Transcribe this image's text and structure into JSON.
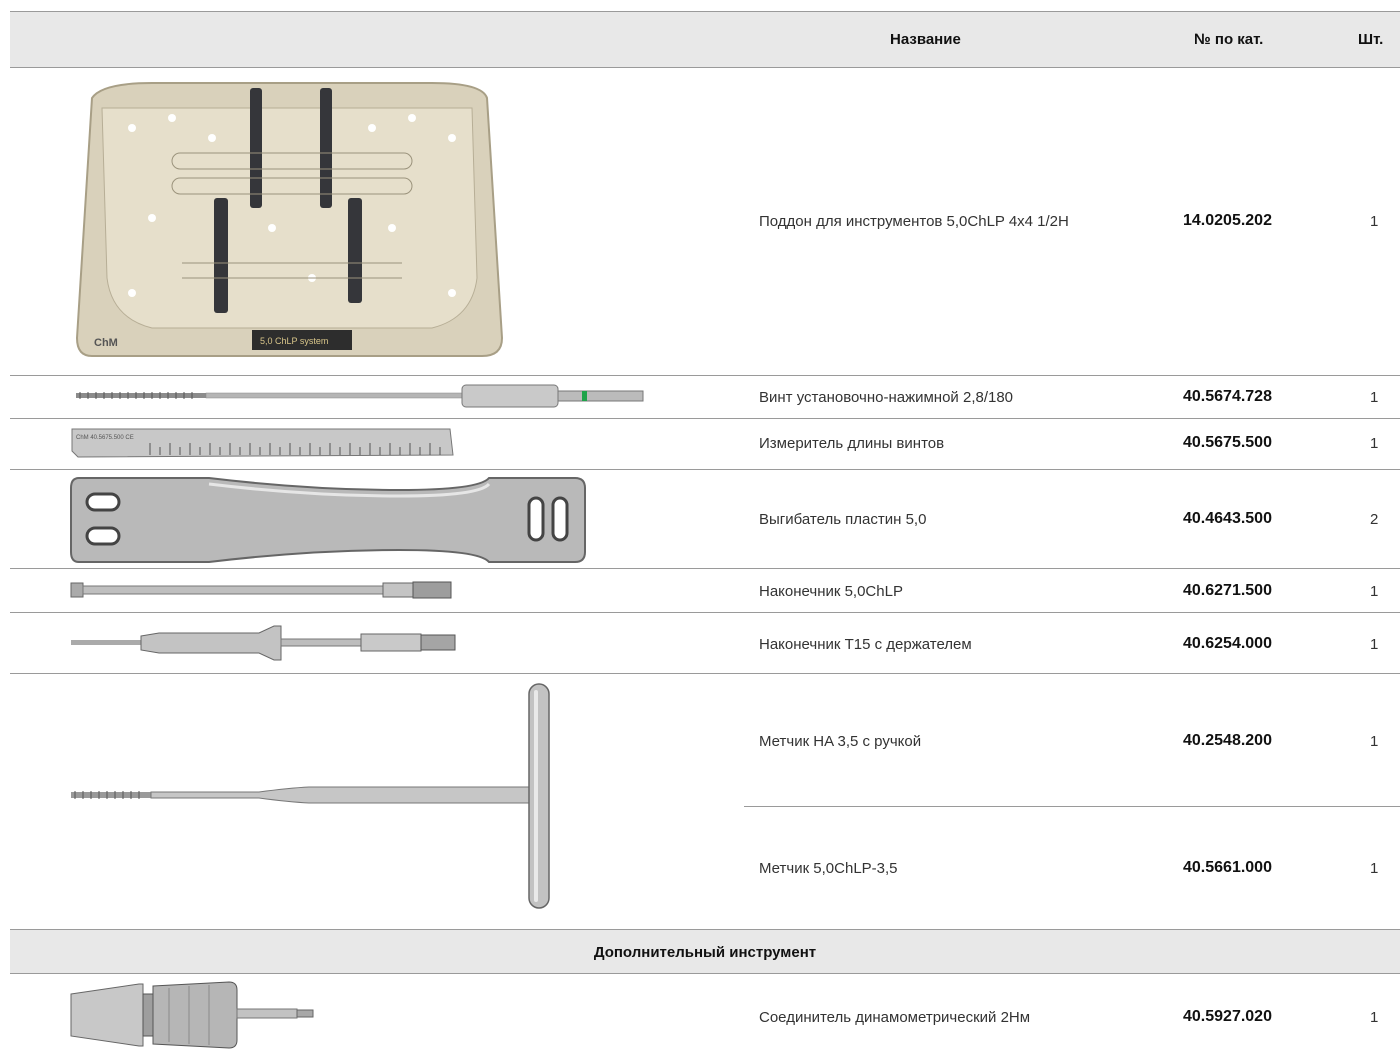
{
  "header": {
    "name": "Название",
    "catalog": "№ по кат.",
    "qty": "Шт."
  },
  "items": [
    {
      "name": "Поддон для инструментов 5,0ChLP 4x4 1/2H",
      "catalog": "14.0205.202",
      "qty": "1",
      "image": "instrument-tray"
    },
    {
      "name": "Винт установочно-нажимной 2,8/180",
      "catalog": "40.5674.728",
      "qty": "1",
      "image": "setting-screw"
    },
    {
      "name": "Измеритель длины винтов",
      "catalog": "40.5675.500",
      "qty": "1",
      "image": "screw-length-gauge"
    },
    {
      "name": "Выгибатель пластин 5,0",
      "catalog": "40.4643.500",
      "qty": "2",
      "image": "plate-bender"
    },
    {
      "name": "Наконечник 5,0ChLP",
      "catalog": "40.6271.500",
      "qty": "1",
      "image": "tip-rod"
    },
    {
      "name": "Наконечник T15 с держателем",
      "catalog": "40.6254.000",
      "qty": "1",
      "image": "t15-tip-holder"
    },
    {
      "name": "Метчик HA 3,5 с ручкой",
      "catalog": "40.2548.200",
      "qty": "1",
      "image": "tap-t-handle"
    },
    {
      "name": "Метчик 5,0ChLP-3,5",
      "catalog": "40.5661.000",
      "qty": "1",
      "image": "tap-t-handle"
    }
  ],
  "additional": {
    "title": "Дополнительный инструмент",
    "items": [
      {
        "name": "Соединитель динамометрический 2Нм",
        "catalog": "40.5927.020",
        "qty": "1",
        "image": "torque-connector"
      }
    ]
  },
  "tray_labels": {
    "brand": "ChM",
    "plate": "5,0 ChLP system"
  },
  "gauge_label": "ChM 40.5675.500 CE"
}
